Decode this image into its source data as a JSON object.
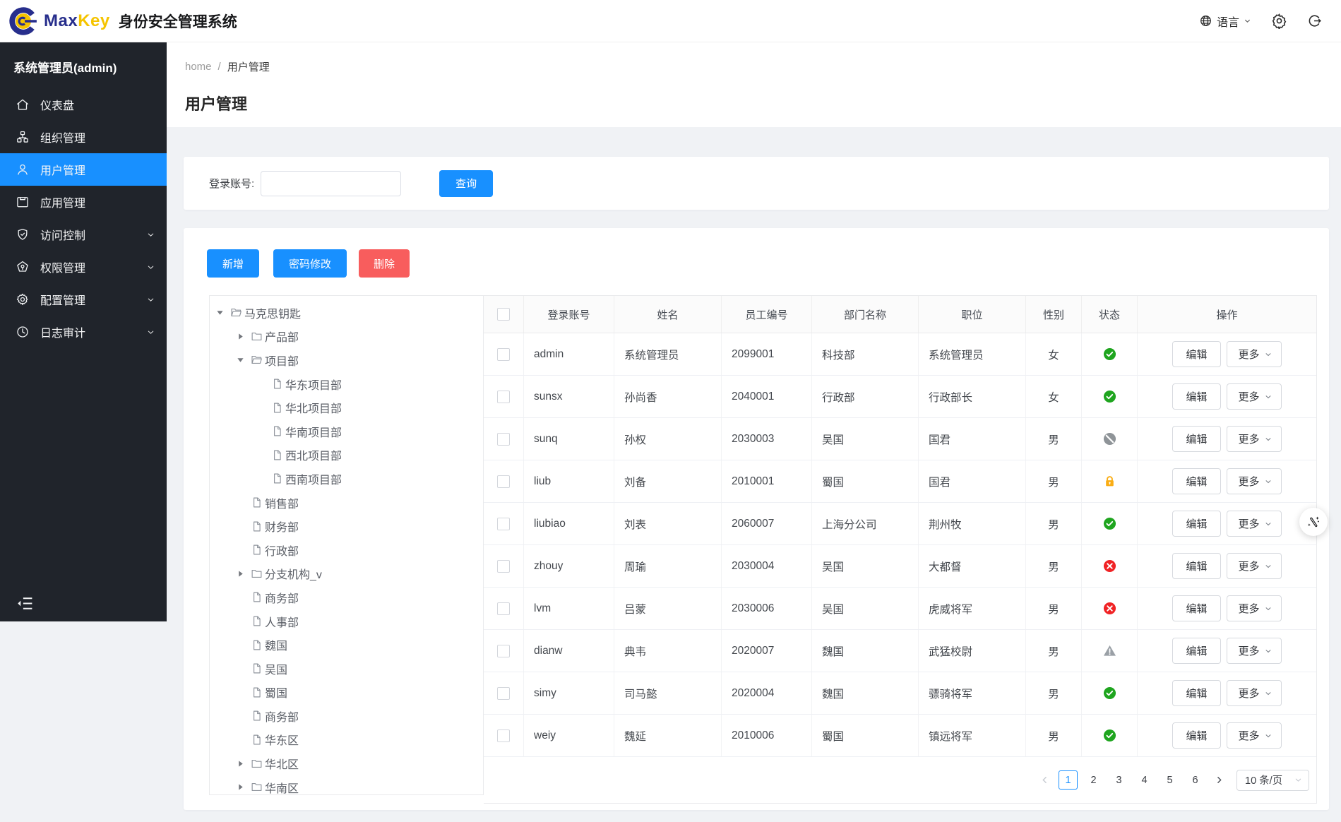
{
  "colors": {
    "accent": "#1890ff",
    "danger": "#f85d5d",
    "sidebar_bg": "#20242b",
    "status_active": "#1fa51f",
    "status_disabled": "#8f9498",
    "status_locked": "#faad14",
    "status_error": "#f02325",
    "status_warning": "#9aa0a6"
  },
  "header": {
    "brand_max": "Max",
    "brand_key": "Key",
    "system_title": "身份安全管理系统",
    "language_label": "语言"
  },
  "sidebar": {
    "user_title": "系统管理员(admin)",
    "items": [
      {
        "key": "dashboard",
        "label": "仪表盘",
        "icon": "dashboard-icon",
        "active": false,
        "expandable": false
      },
      {
        "key": "org",
        "label": "组织管理",
        "icon": "org-icon",
        "active": false,
        "expandable": false
      },
      {
        "key": "users",
        "label": "用户管理",
        "icon": "user-icon",
        "active": true,
        "expandable": false
      },
      {
        "key": "apps",
        "label": "应用管理",
        "icon": "app-icon",
        "active": false,
        "expandable": false
      },
      {
        "key": "access-control",
        "label": "访问控制",
        "icon": "shield-icon",
        "active": false,
        "expandable": true
      },
      {
        "key": "permissions",
        "label": "权限管理",
        "icon": "medal-icon",
        "active": false,
        "expandable": true
      },
      {
        "key": "config",
        "label": "配置管理",
        "icon": "gear-icon",
        "active": false,
        "expandable": true
      },
      {
        "key": "audit-log",
        "label": "日志审计",
        "icon": "clock-icon",
        "active": false,
        "expandable": true
      }
    ]
  },
  "breadcrumb": {
    "home": "home",
    "separator": "/",
    "current": "用户管理"
  },
  "page": {
    "title": "用户管理"
  },
  "search": {
    "label": "登录账号:",
    "input_value": "",
    "query_button": "查询"
  },
  "toolbar": {
    "add": "新增",
    "change_password": "密码修改",
    "delete": "删除"
  },
  "tree": {
    "items": [
      {
        "label": "马克思钥匙",
        "level": 0,
        "caret": "down",
        "icon": "folder-open-icon"
      },
      {
        "label": "产品部",
        "level": 1,
        "caret": "right",
        "icon": "folder-icon"
      },
      {
        "label": "项目部",
        "level": 1,
        "caret": "down",
        "icon": "folder-open-icon"
      },
      {
        "label": "华东项目部",
        "level": 2,
        "caret": "none",
        "icon": "doc-icon"
      },
      {
        "label": "华北项目部",
        "level": 2,
        "caret": "none",
        "icon": "doc-icon"
      },
      {
        "label": "华南项目部",
        "level": 2,
        "caret": "none",
        "icon": "doc-icon"
      },
      {
        "label": "西北项目部",
        "level": 2,
        "caret": "none",
        "icon": "doc-icon"
      },
      {
        "label": "西南项目部",
        "level": 2,
        "caret": "none",
        "icon": "doc-icon"
      },
      {
        "label": "销售部",
        "level": 1,
        "caret": "none",
        "icon": "doc-icon"
      },
      {
        "label": "财务部",
        "level": 1,
        "caret": "none",
        "icon": "doc-icon"
      },
      {
        "label": "行政部",
        "level": 1,
        "caret": "none",
        "icon": "doc-icon"
      },
      {
        "label": "分支机构_v",
        "level": 1,
        "caret": "right",
        "icon": "folder-icon"
      },
      {
        "label": "商务部",
        "level": 1,
        "caret": "none",
        "icon": "doc-icon"
      },
      {
        "label": "人事部",
        "level": 1,
        "caret": "none",
        "icon": "doc-icon"
      },
      {
        "label": "魏国",
        "level": 1,
        "caret": "none",
        "icon": "doc-icon"
      },
      {
        "label": "吴国",
        "level": 1,
        "caret": "none",
        "icon": "doc-icon"
      },
      {
        "label": "蜀国",
        "level": 1,
        "caret": "none",
        "icon": "doc-icon"
      },
      {
        "label": "商务部",
        "level": 1,
        "caret": "none",
        "icon": "doc-icon"
      },
      {
        "label": "华东区",
        "level": 1,
        "caret": "none",
        "icon": "doc-icon"
      },
      {
        "label": "华北区",
        "level": 1,
        "caret": "right",
        "icon": "folder-icon"
      },
      {
        "label": "华南区",
        "level": 1,
        "caret": "right",
        "icon": "folder-icon"
      }
    ]
  },
  "table": {
    "headers": [
      "登录账号",
      "姓名",
      "员工编号",
      "部门名称",
      "职位",
      "性别",
      "状态",
      "操作"
    ],
    "edit_label": "编辑",
    "more_label": "更多",
    "rows": [
      {
        "account": "admin",
        "name": "系统管理员",
        "employee_id": "2099001",
        "department": "科技部",
        "position": "系统管理员",
        "gender": "女",
        "status": "active"
      },
      {
        "account": "sunsx",
        "name": "孙尚香",
        "employee_id": "2040001",
        "department": "行政部",
        "position": "行政部长",
        "gender": "女",
        "status": "active"
      },
      {
        "account": "sunq",
        "name": "孙权",
        "employee_id": "2030003",
        "department": "吴国",
        "position": "国君",
        "gender": "男",
        "status": "disabled"
      },
      {
        "account": "liub",
        "name": "刘备",
        "employee_id": "2010001",
        "department": "蜀国",
        "position": "国君",
        "gender": "男",
        "status": "locked"
      },
      {
        "account": "liubiao",
        "name": "刘表",
        "employee_id": "2060007",
        "department": "上海分公司",
        "position": "荆州牧",
        "gender": "男",
        "status": "active"
      },
      {
        "account": "zhouy",
        "name": "周瑜",
        "employee_id": "2030004",
        "department": "吴国",
        "position": "大都督",
        "gender": "男",
        "status": "error"
      },
      {
        "account": "lvm",
        "name": "吕蒙",
        "employee_id": "2030006",
        "department": "吴国",
        "position": "虎威将军",
        "gender": "男",
        "status": "error"
      },
      {
        "account": "dianw",
        "name": "典韦",
        "employee_id": "2020007",
        "department": "魏国",
        "position": "武猛校尉",
        "gender": "男",
        "status": "warning"
      },
      {
        "account": "simy",
        "name": "司马懿",
        "employee_id": "2020004",
        "department": "魏国",
        "position": "骠骑将军",
        "gender": "男",
        "status": "active"
      },
      {
        "account": "weiy",
        "name": "魏延",
        "employee_id": "2010006",
        "department": "蜀国",
        "position": "镇远将军",
        "gender": "男",
        "status": "active"
      }
    ]
  },
  "pagination": {
    "pages": [
      "1",
      "2",
      "3",
      "4",
      "5",
      "6"
    ],
    "current": "1",
    "page_size": "10 条/页"
  }
}
